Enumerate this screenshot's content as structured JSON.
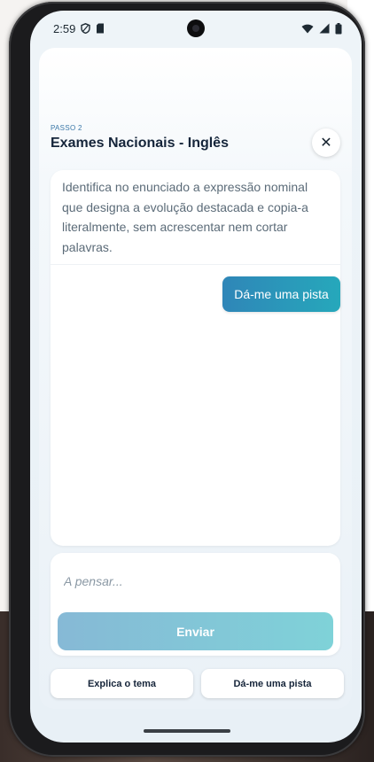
{
  "status_bar": {
    "time": "2:59",
    "icons": [
      "shield-icon",
      "sd-card-icon",
      "wifi-icon",
      "signal-icon",
      "battery-icon"
    ]
  },
  "header": {
    "step_label": "PASSO 2",
    "title": "Exames Nacionais - Inglês",
    "close_symbol": "✕"
  },
  "chat": {
    "prompt": "Identifica no enunciado a expressão nominal que designa a evolução destacada e copia-a literalmente, sem acrescentar nem cortar palavras.",
    "user_message": "Dá-me uma pista"
  },
  "composer": {
    "placeholder": "A pensar...",
    "send_label": "Enviar"
  },
  "quick_actions": {
    "explain_label": "Explica o tema",
    "hint_label": "Dá-me uma pista"
  },
  "colors": {
    "accent_start": "#2f86b8",
    "accent_end": "#26a8bb",
    "send_start": "#86b9d6",
    "send_end": "#7fd2d8",
    "title": "#15253a"
  }
}
